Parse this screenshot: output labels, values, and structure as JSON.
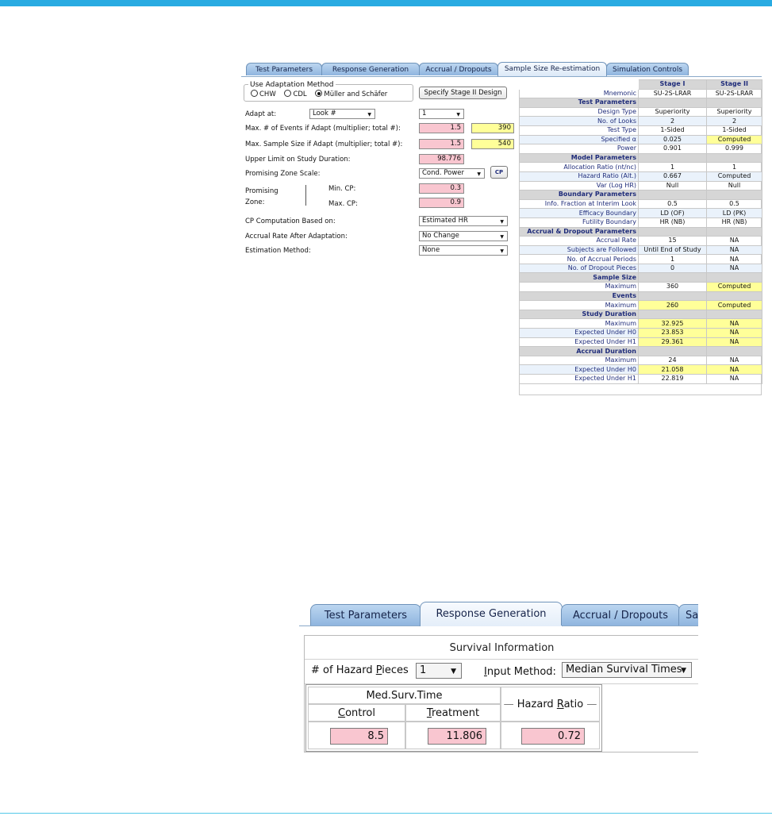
{
  "top": {
    "tabs": [
      "Test Parameters",
      "Response Generation",
      "Accrual / Dropouts",
      "Sample Size Re-estimation",
      "Simulation Controls"
    ],
    "adaptation_group_title": "Use Adaptation Method",
    "methods": [
      "CHW",
      "CDL",
      "Müller and Schäfer"
    ],
    "specify_button": "Specify Stage II Design",
    "adapt_at_label": "Adapt at:",
    "adapt_at_select": "Look #",
    "adapt_at_value": "1",
    "max_events_label": "Max. # of Events if Adapt (multiplier; total #):",
    "max_events_mult": "1.5",
    "max_events_total": "390",
    "max_sample_label": "Max. Sample Size if Adapt (multiplier; total #):",
    "max_sample_mult": "1.5",
    "max_sample_total": "540",
    "upper_limit_label": "Upper Limit on Study Duration:",
    "upper_limit_value": "98.776",
    "pz_scale_label": "Promising Zone Scale:",
    "pz_scale_select": "Cond. Power",
    "cp_button": "CP",
    "promising_label1": "Promising",
    "promising_label2": "Zone:",
    "min_cp_label": "Min. CP:",
    "min_cp_value": "0.3",
    "max_cp_label": "Max. CP:",
    "max_cp_value": "0.9",
    "cp_based_label": "CP Computation Based on:",
    "cp_based_select": "Estimated HR",
    "accrual_after_label": "Accrual Rate After Adaptation:",
    "accrual_after_select": "No Change",
    "estimation_label": "Estimation Method:",
    "estimation_select": "None"
  },
  "summary": {
    "col_stage1": "Stage I",
    "col_stage2": "Stage II",
    "rows": [
      {
        "type": "row",
        "label": "Mnemonic",
        "s1": "SU-2S-LRAR",
        "s2": "SU-2S-LRAR"
      },
      {
        "type": "sec",
        "label": "Test Parameters"
      },
      {
        "type": "row",
        "label": "Design Type",
        "s1": "Superiority",
        "s2": "Superiority"
      },
      {
        "type": "row",
        "label": "No. of Looks",
        "s1": "2",
        "s2": "2"
      },
      {
        "type": "row",
        "label": "Test Type",
        "s1": "1-Sided",
        "s2": "1-Sided"
      },
      {
        "type": "row",
        "label": "Specified α",
        "s1": "0.025",
        "s2": "Computed",
        "h2": true
      },
      {
        "type": "row",
        "label": "Power",
        "s1": "0.901",
        "s2": "0.999"
      },
      {
        "type": "sec",
        "label": "Model Parameters"
      },
      {
        "type": "row",
        "label": "Allocation Ratio (nt/nc)",
        "s1": "1",
        "s2": "1"
      },
      {
        "type": "row",
        "label": "Hazard Ratio (Alt.)",
        "s1": "0.667",
        "s2": "Computed"
      },
      {
        "type": "row",
        "label": "Var (Log HR)",
        "s1": "Null",
        "s2": "Null"
      },
      {
        "type": "sec",
        "label": "Boundary Parameters"
      },
      {
        "type": "row",
        "label": "Info. Fraction at Interim Look",
        "s1": "0.5",
        "s2": "0.5"
      },
      {
        "type": "row",
        "label": "Efficacy Boundary",
        "s1": "LD (OF)",
        "s2": "LD (PK)"
      },
      {
        "type": "row",
        "label": "Futility Boundary",
        "s1": "HR (NB)",
        "s2": "HR (NB)"
      },
      {
        "type": "sec",
        "label": "Accrual & Dropout Parameters"
      },
      {
        "type": "row",
        "label": "Accrual Rate",
        "s1": "15",
        "s2": "NA"
      },
      {
        "type": "row",
        "label": "Subjects are Followed",
        "s1": "Until End of Study",
        "s2": "NA"
      },
      {
        "type": "row",
        "label": "No. of Accrual Periods",
        "s1": "1",
        "s2": "NA"
      },
      {
        "type": "row",
        "label": "No. of Dropout Pieces",
        "s1": "0",
        "s2": "NA"
      },
      {
        "type": "sec",
        "label": "Sample Size"
      },
      {
        "type": "row",
        "label": "Maximum",
        "s1": "360",
        "s2": "Computed",
        "h2": true
      },
      {
        "type": "sec",
        "label": "Events"
      },
      {
        "type": "row",
        "label": "Maximum",
        "s1": "260",
        "s2": "Computed",
        "h1": true,
        "h2": true
      },
      {
        "type": "sec",
        "label": "Study Duration"
      },
      {
        "type": "row",
        "label": "Maximum",
        "s1": "32.925",
        "s2": "NA",
        "h1": true,
        "h2": true
      },
      {
        "type": "row",
        "label": "Expected Under H0",
        "s1": "23.853",
        "s2": "NA",
        "h1": true,
        "h2": true
      },
      {
        "type": "row",
        "label": "Expected Under H1",
        "s1": "29.361",
        "s2": "NA",
        "h1": true,
        "h2": true
      },
      {
        "type": "sec",
        "label": "Accrual Duration"
      },
      {
        "type": "row",
        "label": "Maximum",
        "s1": "24",
        "s2": "NA"
      },
      {
        "type": "row",
        "label": "Expected Under H0",
        "s1": "21.058",
        "s2": "NA",
        "h1": true,
        "h2": true
      },
      {
        "type": "row",
        "label": "Expected Under H1",
        "s1": "22.819",
        "s2": "NA"
      }
    ]
  },
  "bottom": {
    "tabs": [
      "Test Parameters",
      "Response Generation",
      "Accrual / Dropouts",
      "Sa"
    ],
    "title": "Survival Information",
    "hazard_pieces_pre": "# of Hazard ",
    "hazard_pieces_u": "P",
    "hazard_pieces_post": "ieces",
    "hazard_pieces_value": "1",
    "input_method_u": "I",
    "input_method_post": "nput Method:",
    "input_method_value": "Median Survival Times",
    "med_surv_header": "Med.Surv.Time",
    "control_u": "C",
    "control_post": "ontrol",
    "treatment_u": "T",
    "treatment_post": "reatment",
    "hazard_ratio_pre": "Hazard ",
    "hazard_ratio_u": "R",
    "hazard_ratio_post": "atio",
    "control_value": "8.5",
    "treatment_value": "11.806",
    "hazard_ratio_value": "0.72"
  }
}
